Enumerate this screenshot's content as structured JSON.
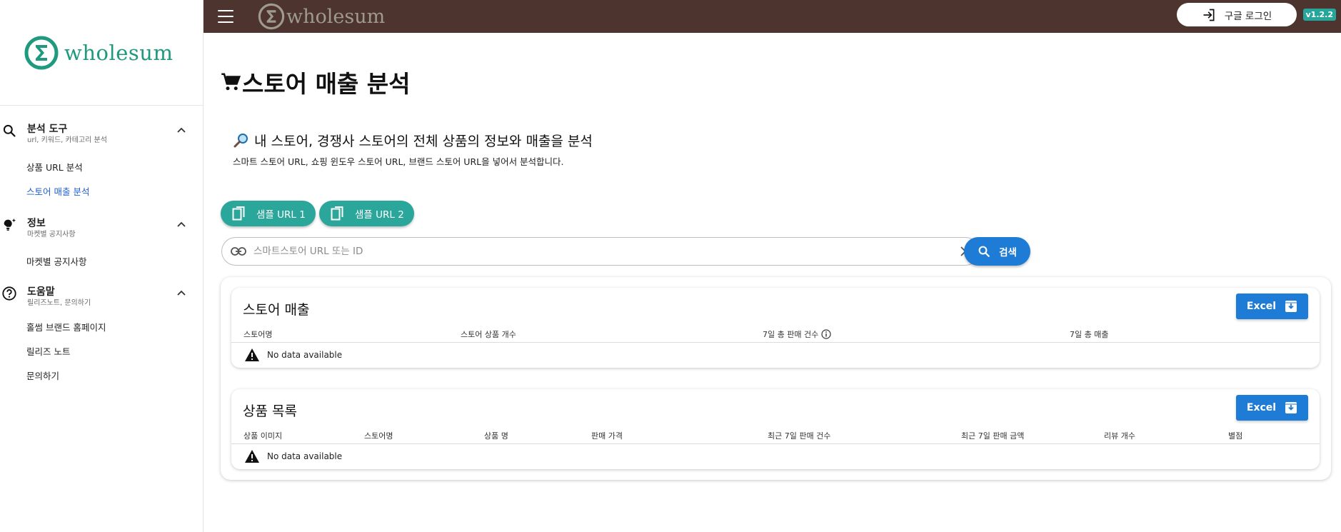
{
  "app": {
    "logo_text": "wholesum",
    "version": "v1.2.2",
    "login_label": "구글 로그인",
    "brand_color": "#1f9a7f",
    "topbar_color": "#4e342e"
  },
  "sidebar": {
    "groups": [
      {
        "title": "분석 도구",
        "subtitle": "url, 키워드, 카테고리 분석",
        "icon": "search-icon",
        "items": [
          {
            "label": "상품 URL 분석"
          },
          {
            "label": "스토어 매출 분석"
          }
        ]
      },
      {
        "title": "정보",
        "subtitle": "마켓별 공지사항",
        "icon": "lightbulb-icon",
        "items": [
          {
            "label": "마켓별 공지사항"
          }
        ]
      },
      {
        "title": "도움말",
        "subtitle": "릴리즈노트, 문의하기",
        "icon": "help-circle-icon",
        "items": [
          {
            "label": "홀썸 브랜드 홈페이지"
          },
          {
            "label": "릴리즈 노트"
          },
          {
            "label": "문의하기"
          }
        ]
      }
    ]
  },
  "main": {
    "page_title": "스토어 매출 분석",
    "section_title": "내 스토어, 경쟁사 스토어의 전체 상품의 정보와 매출을 분석",
    "section_desc": "스마트 스토어 URL, 쇼핑 윈도우 스토어 URL, 브랜드 스토어 URL을 넣어서 분석합니다.",
    "sample_buttons": [
      "샘플 URL 1",
      "샘플 URL 2"
    ],
    "search": {
      "placeholder": "스마트스토어 URL 또는 ID",
      "value": "",
      "button_label": "검색"
    },
    "store_sales": {
      "title": "스토어 매출",
      "excel_label": "Excel",
      "columns": [
        "스토어명",
        "스토어 상품 개수",
        "7일 총 판매 건수",
        "7일 총 매출"
      ],
      "empty_text": "No data available"
    },
    "product_list": {
      "title": "상품 목록",
      "excel_label": "Excel",
      "columns": [
        "상품 이미지",
        "스토어명",
        "상품 명",
        "판매 가격",
        "최근 7일 판매 건수",
        "최근 7일 판매 금액",
        "리뷰 개수",
        "별점"
      ],
      "empty_text": "No data available"
    }
  }
}
